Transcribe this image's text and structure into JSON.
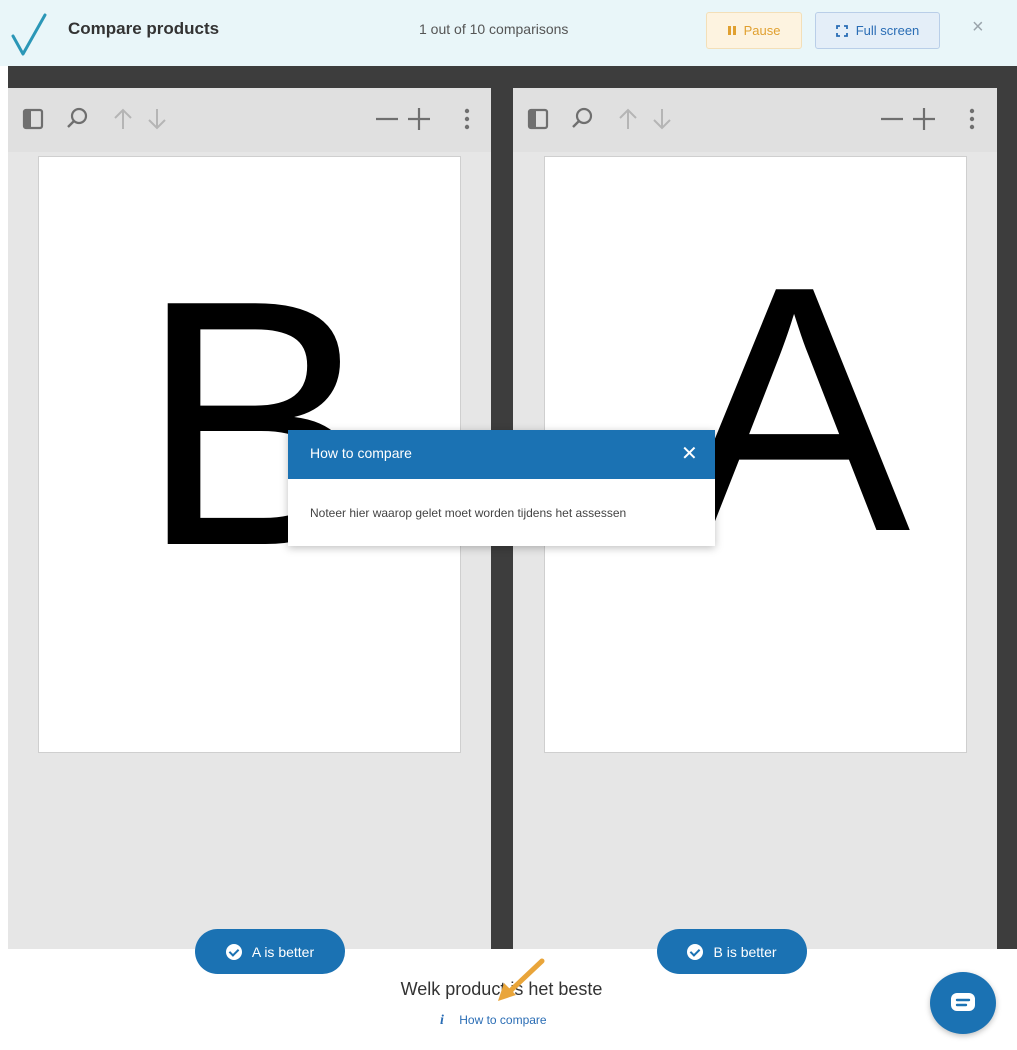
{
  "header": {
    "title": "Compare products",
    "progress": "1 out of 10 comparisons",
    "pause_label": "Pause",
    "fullscreen_label": "Full screen",
    "close_symbol": "×"
  },
  "viewer_a": {
    "toolbar_icons": [
      "sidebar-toggle-icon",
      "search-icon",
      "arrow-up-icon",
      "arrow-down-icon",
      "zoom-out-icon",
      "zoom-in-icon",
      "more-vertical-icon"
    ],
    "letter": "B"
  },
  "viewer_b": {
    "toolbar_icons": [
      "sidebar-toggle-icon",
      "search-icon",
      "arrow-up-icon",
      "arrow-down-icon",
      "zoom-out-icon",
      "zoom-in-icon",
      "more-vertical-icon"
    ],
    "letter": "A"
  },
  "modal": {
    "title": "How to compare",
    "body": "Noteer hier waarop gelet moet worden tijdens het assessen",
    "close_symbol": "✕"
  },
  "footer": {
    "a_better_label": "A is better",
    "b_better_label": "B is better",
    "question": "Welk product is het beste",
    "info_symbol": "i",
    "how_link": "How to compare"
  },
  "colors": {
    "header_bg": "#e9f6f9",
    "primary": "#1b72b3",
    "pause_text": "#e0a030",
    "annotation_arrow": "#e9a53a",
    "frame": "#3d3d3d"
  }
}
